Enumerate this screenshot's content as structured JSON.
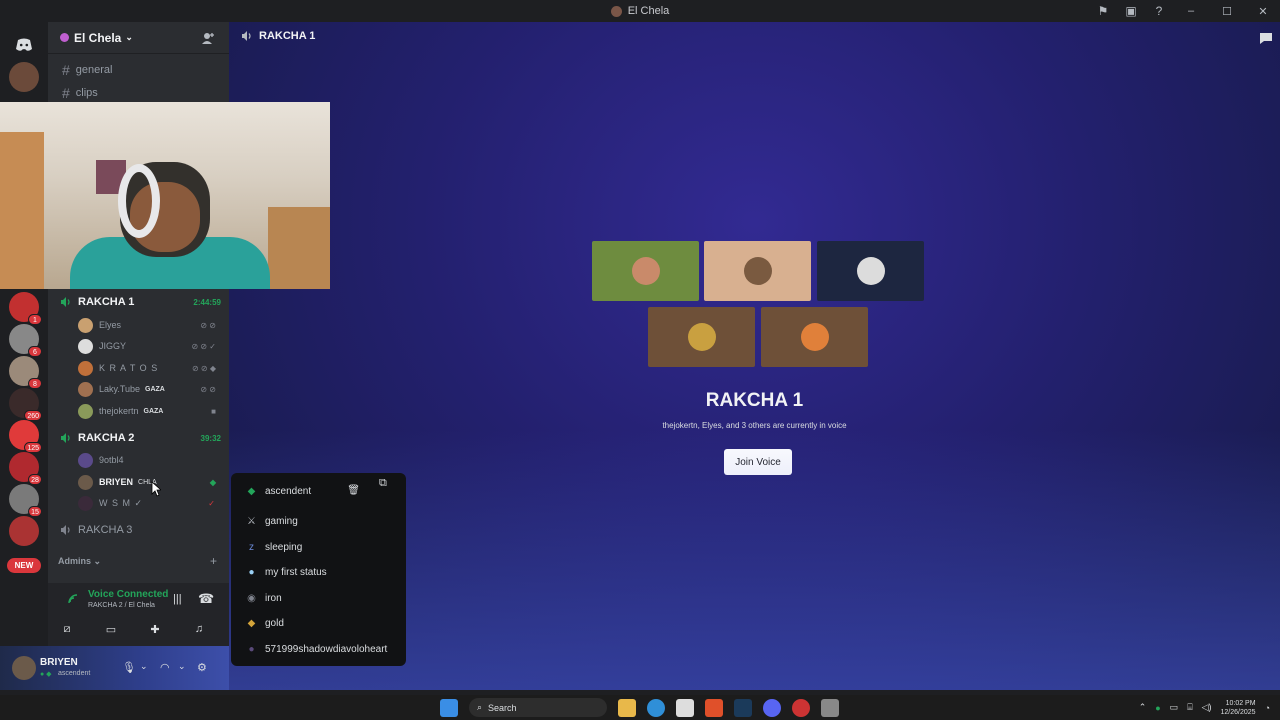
{
  "window": {
    "title": "El Chela"
  },
  "guild": {
    "name": "El Chela"
  },
  "text_channels": [
    {
      "name": "general"
    },
    {
      "name": "clips"
    }
  ],
  "voice_channels": [
    {
      "name": "RAKCHA 1",
      "timer": "2:44:59"
    },
    {
      "name": "RAKCHA 2",
      "timer": "39:32"
    },
    {
      "name": "RAKCHA 3"
    }
  ],
  "rakcha1_users": [
    {
      "name": "Elyes"
    },
    {
      "name": "JIGGY"
    },
    {
      "name": "K R A T O S"
    },
    {
      "name": "Laky.Tube",
      "tag": "GAZA"
    },
    {
      "name": "thejokertn",
      "tag": "GAZA"
    }
  ],
  "rakcha2_users": [
    {
      "name": "9otbl4"
    },
    {
      "name": "BRIYEN",
      "tag": "CHLA"
    },
    {
      "name": "W S M ✓"
    }
  ],
  "category": {
    "name": "Admins"
  },
  "new_pill": "NEW",
  "server_badges": [
    "1",
    "6",
    "8",
    "260",
    "125",
    "28",
    "15"
  ],
  "voice_status": {
    "title": "Voice Connected",
    "subtitle": "RAKCHA 2 / El Chela"
  },
  "user_panel": {
    "name": "BRIYEN",
    "status": "ascendent"
  },
  "main": {
    "channel_header": "RAKCHA 1",
    "title": "RAKCHA 1",
    "description": "thejokertn, Elyes, and 3 others are currently in voice",
    "join_label": "Join Voice"
  },
  "status_menu": {
    "current": "ascendent",
    "items": [
      {
        "label": "gaming",
        "icon": "crossed-swords-icon"
      },
      {
        "label": "sleeping",
        "icon": "zzz-icon"
      },
      {
        "label": "my first status",
        "icon": "speech-bubble-icon"
      },
      {
        "label": "iron",
        "icon": "iron-rank-icon"
      },
      {
        "label": "gold",
        "icon": "gold-rank-icon"
      },
      {
        "label": "571999shadowdiavoloheart",
        "icon": "custom-avatar-icon"
      }
    ]
  },
  "taskbar": {
    "search_label": "Search",
    "time": "10:02 PM",
    "date": "12/26/2025"
  },
  "colors": {
    "voice_green": "#23a55a",
    "accent_red": "#da373c",
    "blurple": "#5865f2"
  }
}
